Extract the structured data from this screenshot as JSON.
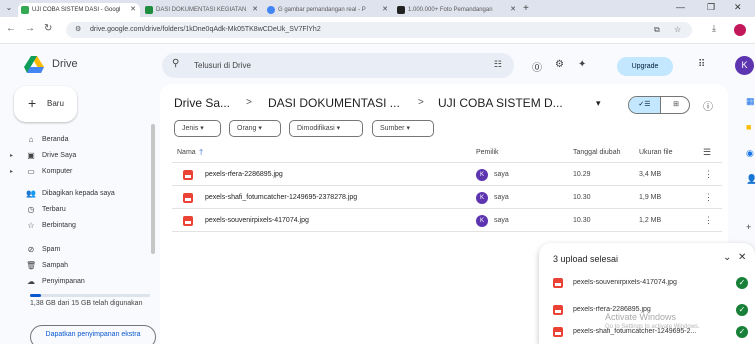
{
  "browser": {
    "tabs": [
      {
        "label": "UJI COBA SISTEM DASI - Googl",
        "color": "#34a853"
      },
      {
        "label": "DASI DOKUMENTASI KEGIATAN",
        "color": "#1e8e3e"
      },
      {
        "label": "G gambar pemandangan real - P",
        "color": "#4285f4"
      },
      {
        "label": "1.000.000+ Foto Pemandangan",
        "color": "#222222"
      }
    ],
    "url": "drive.google.com/drive/folders/1kDne0qAdk-Mk05TK8wCDeUk_SV7FlYh2"
  },
  "header": {
    "brand": "Drive",
    "search_placeholder": "Telusuri di Drive",
    "upgrade_label": "Upgrade",
    "account_initial": "K"
  },
  "sidebar": {
    "new_label": "Baru",
    "items": [
      {
        "label": "Beranda",
        "icon": "home-icon"
      },
      {
        "label": "Drive Saya",
        "icon": "my-drive-icon"
      },
      {
        "label": "Komputer",
        "icon": "computer-icon"
      },
      {
        "label": "Dibagikan kepada saya",
        "icon": "shared-icon"
      },
      {
        "label": "Terbaru",
        "icon": "clock-icon"
      },
      {
        "label": "Berbintang",
        "icon": "star-icon"
      },
      {
        "label": "Spam",
        "icon": "spam-icon"
      },
      {
        "label": "Sampah",
        "icon": "trash-icon"
      },
      {
        "label": "Penyimpanan",
        "icon": "cloud-icon"
      }
    ],
    "storage_text": "1,38 GB dari 15 GB telah digunakan",
    "storage_fraction": 0.092,
    "get_storage_label": "Dapatkan penyimpanan ekstra"
  },
  "breadcrumb": {
    "items": [
      "Drive Sa...",
      "DASI DOKUMENTASI ...",
      "UJI COBA SISTEM D..."
    ],
    "separator": ">"
  },
  "filters": [
    "Jenis",
    "Orang",
    "Dimodifikasi",
    "Sumber"
  ],
  "table": {
    "headers": {
      "name": "Nama",
      "owner": "Pemilik",
      "modified": "Tanggal diubah",
      "size": "Ukuran file"
    },
    "rows": [
      {
        "name": "pexels-rfera-2286895.jpg",
        "owner": "saya",
        "modified": "10.29",
        "size": "3,4 MB"
      },
      {
        "name": "pexels-shafi_fotumcatcher-1249695-2378278.jpg",
        "owner": "saya",
        "modified": "10.30",
        "size": "1,9 MB"
      },
      {
        "name": "pexels-souvenirpixels-417074.jpg",
        "owner": "saya",
        "modified": "10.30",
        "size": "1,2 MB"
      }
    ]
  },
  "upload": {
    "title": "3 upload selesai",
    "items": [
      "pexels-souvenirpixels-417074.jpg",
      "pexels-rfera-2286895.jpg",
      "pexels-shafi_fotumcatcher-1249695-2..."
    ]
  },
  "watermark": {
    "line1": "Activate Windows",
    "line2": "Go to Settings to activate Windows."
  },
  "colors": {
    "accent": "#0b57d0",
    "upgrade_bg": "#c2e7ff",
    "file_red": "#ea4335",
    "success_green": "#188038",
    "avatar_purple": "#5e35b1"
  }
}
